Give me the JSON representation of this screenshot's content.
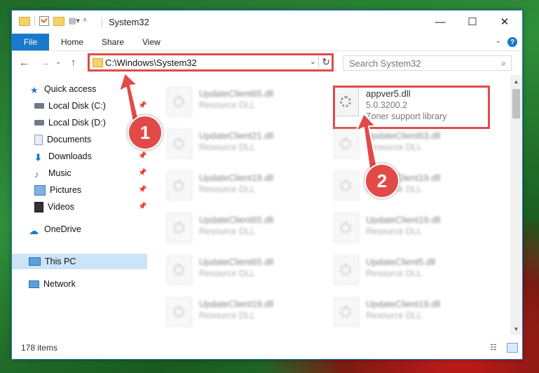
{
  "window": {
    "title": "System32"
  },
  "ribbon": {
    "tabs": [
      "File",
      "Home",
      "Share",
      "View"
    ]
  },
  "address": {
    "path": "C:\\Windows\\System32",
    "search_placeholder": "Search System32"
  },
  "sidebar": {
    "items": [
      {
        "label": "Quick access",
        "icon": "star-icon"
      },
      {
        "label": "Local Disk (C:)",
        "icon": "drive-icon"
      },
      {
        "label": "Local Disk (D:)",
        "icon": "drive-icon"
      },
      {
        "label": "Documents",
        "icon": "document-icon"
      },
      {
        "label": "Downloads",
        "icon": "download-icon"
      },
      {
        "label": "Music",
        "icon": "music-icon"
      },
      {
        "label": "Pictures",
        "icon": "picture-icon"
      },
      {
        "label": "Videos",
        "icon": "video-icon"
      },
      {
        "label": "OneDrive",
        "icon": "cloud-icon"
      },
      {
        "label": "This PC",
        "icon": "computer-icon"
      },
      {
        "label": "Network",
        "icon": "network-icon"
      }
    ]
  },
  "files": [
    {
      "name": "UpdateClient65.dll",
      "type": "Resource DLL"
    },
    {
      "name": "UpdateClient21.dll",
      "type": "Resource DLL"
    },
    {
      "name": "UpdateClient19.dll",
      "type": "Resource DLL"
    },
    {
      "name": "UpdateClient65.dll",
      "type": "Resource DLL"
    },
    {
      "name": "UpdateClient65.dll",
      "type": "Resource DLL"
    },
    {
      "name": "UpdateClient19.dll",
      "type": "Resource DLL"
    },
    {
      "name": "appver5.dll",
      "version": "5.0.3200.2",
      "description": "Zoner support library"
    },
    {
      "name": "UpdateClient63.dll",
      "type": "Resource DLL"
    },
    {
      "name": "UpdateClient19.dll",
      "type": "Resource DLL"
    },
    {
      "name": "UpdateClient19.dll",
      "type": "Resource DLL"
    },
    {
      "name": "UpdateClient5.dll",
      "type": "Resource DLL"
    },
    {
      "name": "UpdateClient19.dll",
      "type": "Resource DLL"
    }
  ],
  "status": {
    "item_count": "178 items"
  },
  "callouts": {
    "one": "1",
    "two": "2"
  },
  "colors": {
    "accent": "#1979ca",
    "highlight": "#e24a4a",
    "selected": "#cce4f7"
  }
}
